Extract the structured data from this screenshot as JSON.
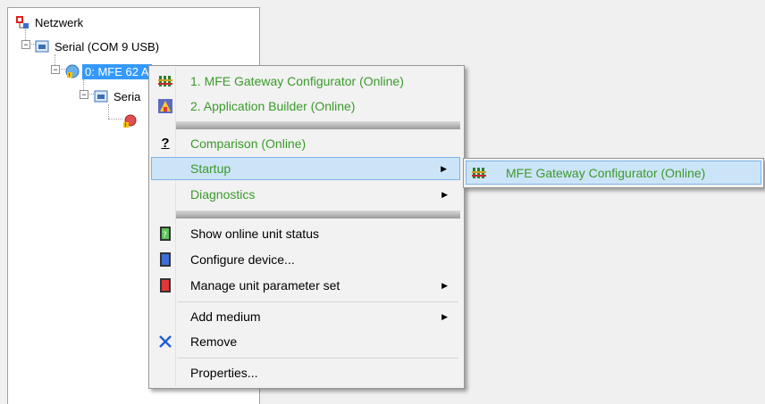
{
  "tree": {
    "nodes": [
      {
        "label": "Netzwerk",
        "icon": "network-icon"
      },
      {
        "label": "Serial (COM 9 USB)",
        "icon": "serial-port-icon"
      },
      {
        "label": "0: MFE 62 A",
        "icon": "gateway-device-icon"
      },
      {
        "label": "Seria",
        "icon": "serial-port-icon"
      },
      {
        "label": "",
        "icon": "device-warning-icon"
      }
    ]
  },
  "context_menu": {
    "items": [
      {
        "label": "1. MFE Gateway Configurator (Online)",
        "icon": "gateway-configurator-icon"
      },
      {
        "label": "2. Application Builder (Online)",
        "icon": "application-builder-icon"
      },
      {
        "label": "Comparison (Online)",
        "icon": "question-icon"
      },
      {
        "label": "Startup",
        "icon": "chevron-right-icon"
      },
      {
        "label": "Diagnostics",
        "icon": "chevron-right-icon"
      },
      {
        "label": "Show online unit status",
        "icon": "green-status-icon"
      },
      {
        "label": "Configure device...",
        "icon": "blue-device-icon"
      },
      {
        "label": "Manage unit parameter set",
        "icon": "red-device-icon"
      },
      {
        "label": "Add medium",
        "icon": "chevron-right-icon"
      },
      {
        "label": "Remove",
        "icon": "remove-x-icon"
      },
      {
        "label": "Properties...",
        "icon": ""
      }
    ]
  },
  "submenu": {
    "items": [
      {
        "label": "MFE Gateway Configurator (Online)",
        "icon": "gateway-configurator-icon"
      }
    ]
  },
  "colors": {
    "selection": "#3399ff",
    "menu_green_text": "#3a9a2a",
    "highlight": "#cce4f7",
    "highlight_border": "#7eb4ea"
  }
}
